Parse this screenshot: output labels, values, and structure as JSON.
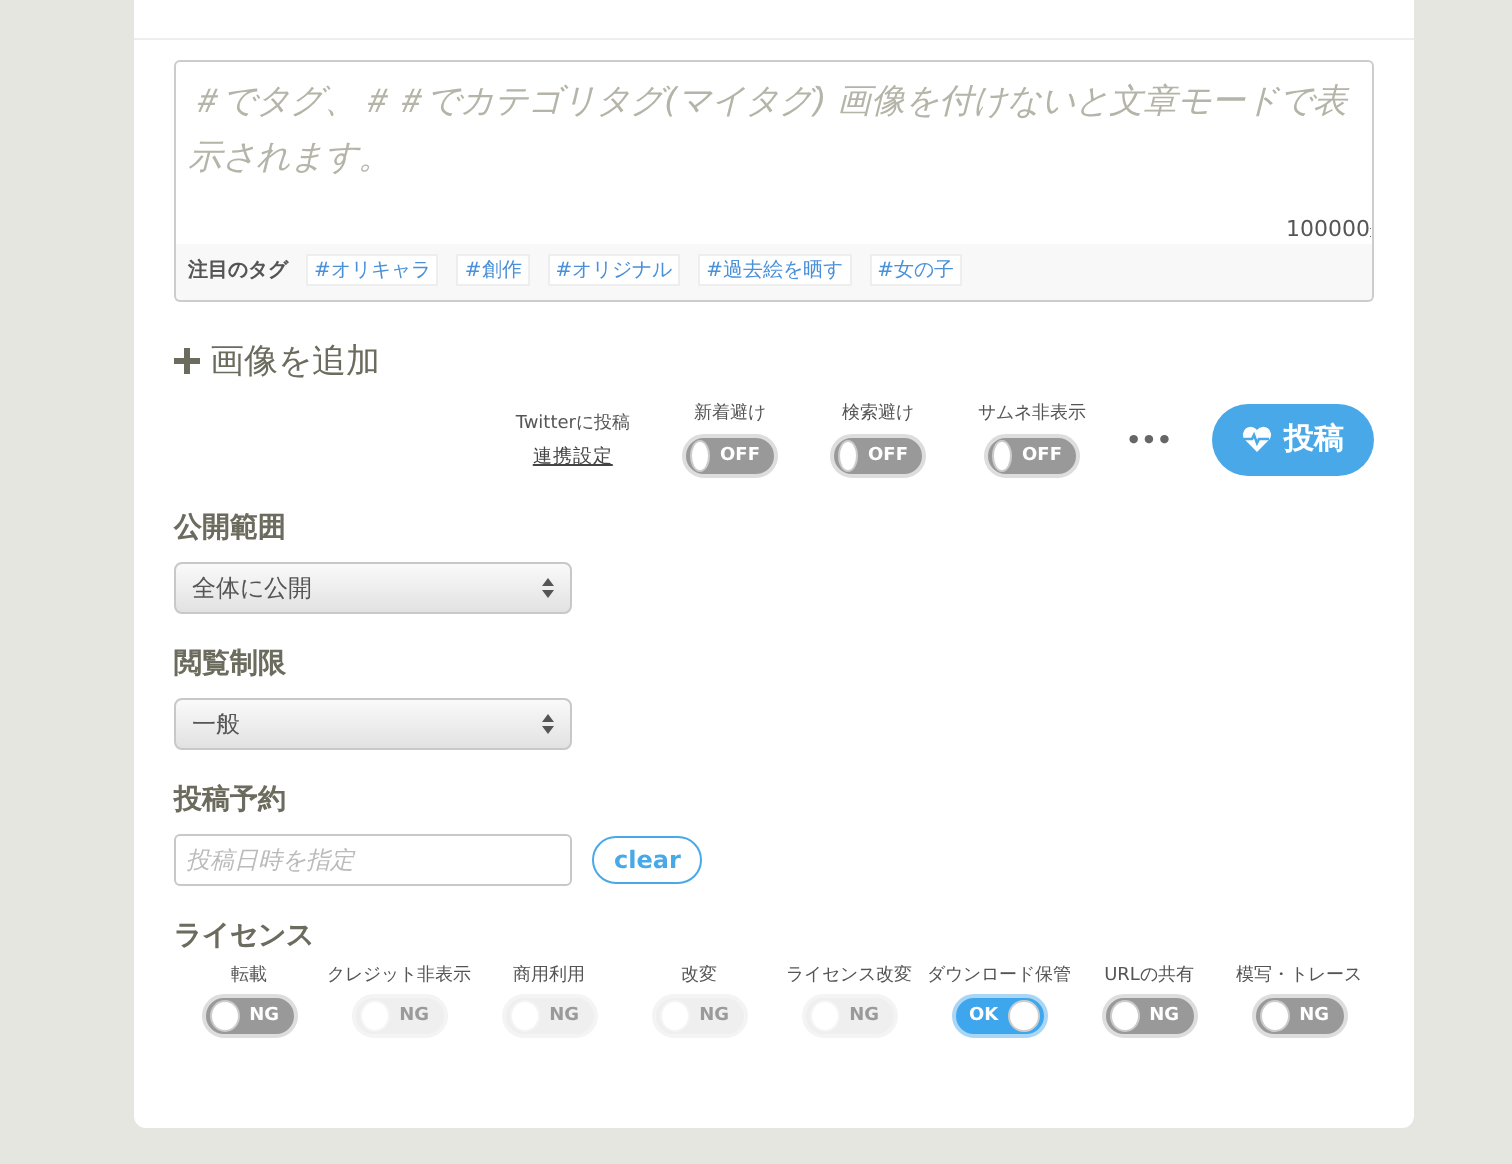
{
  "editor": {
    "placeholder": "＃でタグ、＃＃でカテゴリタグ(マイタグ) 画像を付けないと文章モードで表示されます。",
    "counter": "100000"
  },
  "featured_tags": {
    "label": "注目のタグ",
    "tags": [
      "#オリキャラ",
      "#創作",
      "#オリジナル",
      "#過去絵を晒す",
      "#女の子"
    ]
  },
  "add_image": "画像を追加",
  "post_options": {
    "twitter": {
      "label": "Twitterに投稿",
      "link": "連携設定"
    },
    "toggles": [
      {
        "label": "新着避け",
        "text": "OFF",
        "on": false
      },
      {
        "label": "検索避け",
        "text": "OFF",
        "on": false
      },
      {
        "label": "サムネ非表示",
        "text": "OFF",
        "on": false
      }
    ],
    "more": "•••",
    "post_button": "投稿"
  },
  "visibility": {
    "heading": "公開範囲",
    "value": "全体に公開"
  },
  "restriction": {
    "heading": "閲覧制限",
    "value": "一般"
  },
  "schedule": {
    "heading": "投稿予約",
    "placeholder": "投稿日時を指定",
    "clear": "clear"
  },
  "license": {
    "heading": "ライセンス",
    "items": [
      {
        "label": "転載",
        "text": "NG",
        "on": false,
        "disabled": false
      },
      {
        "label": "クレジット非表示",
        "text": "NG",
        "on": false,
        "disabled": true
      },
      {
        "label": "商用利用",
        "text": "NG",
        "on": false,
        "disabled": true
      },
      {
        "label": "改変",
        "text": "NG",
        "on": false,
        "disabled": true
      },
      {
        "label": "ライセンス改変",
        "text": "NG",
        "on": false,
        "disabled": true
      },
      {
        "label": "ダウンロード保管",
        "text": "OK",
        "on": true,
        "disabled": false
      },
      {
        "label": "URLの共有",
        "text": "NG",
        "on": false,
        "disabled": false
      },
      {
        "label": "模写・トレース",
        "text": "NG",
        "on": false,
        "disabled": false
      }
    ]
  }
}
